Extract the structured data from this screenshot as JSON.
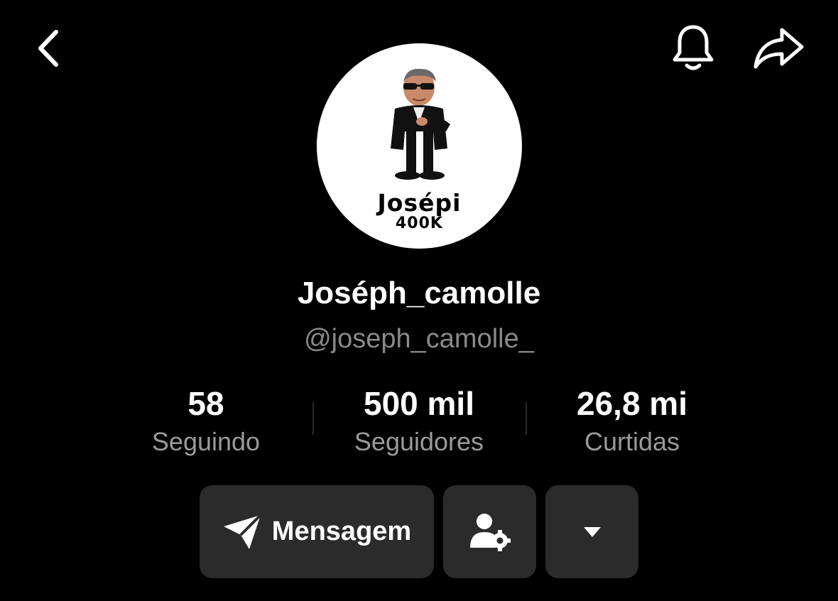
{
  "header": {
    "back_icon": "chevron-left-icon",
    "bell_icon": "bell-icon",
    "share_icon": "share-arrow-icon"
  },
  "avatar": {
    "text_line1": "Josépi",
    "text_line2": "400K"
  },
  "profile": {
    "display_name": "Joséph_camolle",
    "handle": "@joseph_camolle_"
  },
  "stats": {
    "following": {
      "value": "58",
      "label": "Seguindo"
    },
    "followers": {
      "value": "500 mil",
      "label": "Seguidores"
    },
    "likes": {
      "value": "26,8 mi",
      "label": "Curtidas"
    }
  },
  "actions": {
    "message_label": "Mensagem",
    "message_icon": "send-paper-plane-icon",
    "profile_settings_icon": "user-gear-icon",
    "more_icon": "caret-down-icon"
  },
  "colors": {
    "background": "#000000",
    "button_bg": "#2b2b2b",
    "secondary_text": "#9a9a9a"
  }
}
